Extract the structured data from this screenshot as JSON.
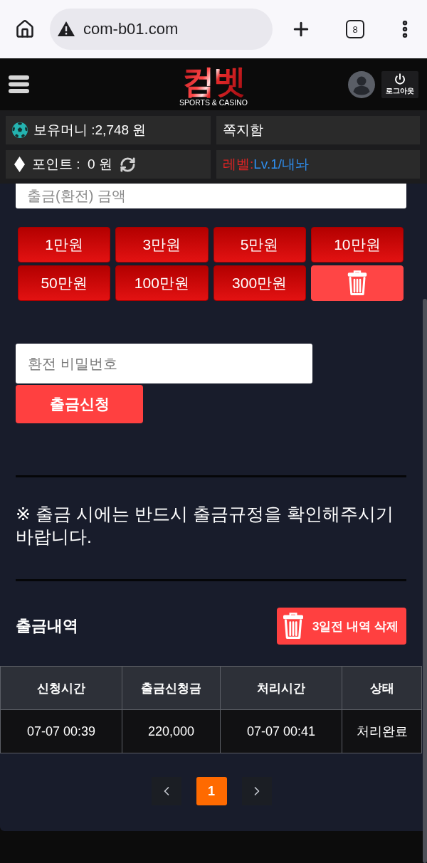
{
  "browser": {
    "url": "com-b01.com",
    "tab_count": "8"
  },
  "header": {
    "logo": "컴벳",
    "logo_tagline": "SPORTS & CASINO",
    "logout_label": "로그아웃"
  },
  "info_bar": {
    "money": "보유머니 :2,748 원",
    "messages": "쪽지함",
    "points": "포인트 :  0 원",
    "level_label": "레벨:",
    "level_value": "Lv.1/내놔"
  },
  "amount_field": {
    "placeholder": "출금(환전) 금액"
  },
  "amount_buttons": [
    {
      "kind": "amount",
      "label": "1만원"
    },
    {
      "kind": "amount",
      "label": "3만원"
    },
    {
      "kind": "amount",
      "label": "5만원"
    },
    {
      "kind": "amount",
      "label": "10만원"
    },
    {
      "kind": "amount",
      "label": "50만원"
    },
    {
      "kind": "amount",
      "label": "100만원"
    },
    {
      "kind": "amount",
      "label": "300만원"
    },
    {
      "kind": "clear"
    }
  ],
  "password_field": {
    "placeholder": "환전 비밀번호"
  },
  "submit_button": "출금신청",
  "notice": "※ 출금 시에는 반드시 출금규정을 확인해주시기 바랍니다.",
  "history": {
    "title": "출금내역",
    "delete_button": "3일전 내역 삭제",
    "columns": [
      "신청시간",
      "출금신청금",
      "처리시간",
      "상태"
    ],
    "rows": [
      [
        "07-07 00:39",
        "220,000",
        "07-07 00:41",
        "처리완료"
      ]
    ]
  },
  "pagination": {
    "pages": [
      {
        "label": "1",
        "selected": true
      }
    ]
  }
}
